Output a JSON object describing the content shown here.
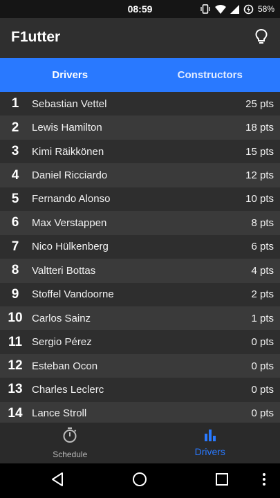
{
  "status_bar": {
    "time": "08:59",
    "battery": "58%"
  },
  "app_bar": {
    "title": "F1utter",
    "action_icon": "lightbulb-icon"
  },
  "tabs": [
    {
      "label": "Drivers",
      "selected": true
    },
    {
      "label": "Constructors",
      "selected": false
    }
  ],
  "drivers": [
    {
      "position": "1",
      "name": "Sebastian Vettel",
      "points": "25 pts"
    },
    {
      "position": "2",
      "name": "Lewis Hamilton",
      "points": "18 pts"
    },
    {
      "position": "3",
      "name": "Kimi Räikkönen",
      "points": "15 pts"
    },
    {
      "position": "4",
      "name": "Daniel Ricciardo",
      "points": "12 pts"
    },
    {
      "position": "5",
      "name": "Fernando Alonso",
      "points": "10 pts"
    },
    {
      "position": "6",
      "name": "Max Verstappen",
      "points": "8 pts"
    },
    {
      "position": "7",
      "name": "Nico Hülkenberg",
      "points": "6 pts"
    },
    {
      "position": "8",
      "name": "Valtteri Bottas",
      "points": "4 pts"
    },
    {
      "position": "9",
      "name": "Stoffel Vandoorne",
      "points": "2 pts"
    },
    {
      "position": "10",
      "name": "Carlos Sainz",
      "points": "1 pts"
    },
    {
      "position": "11",
      "name": "Sergio Pérez",
      "points": "0 pts"
    },
    {
      "position": "12",
      "name": "Esteban Ocon",
      "points": "0 pts"
    },
    {
      "position": "13",
      "name": "Charles Leclerc",
      "points": "0 pts"
    },
    {
      "position": "14",
      "name": "Lance Stroll",
      "points": "0 pts"
    }
  ],
  "bottom_nav": [
    {
      "label": "Schedule",
      "icon": "stopwatch-icon",
      "active": false
    },
    {
      "label": "Drivers",
      "icon": "bar-chart-icon",
      "active": true
    }
  ],
  "colors": {
    "accent": "#2979ff",
    "background": "#2b2b2b"
  }
}
